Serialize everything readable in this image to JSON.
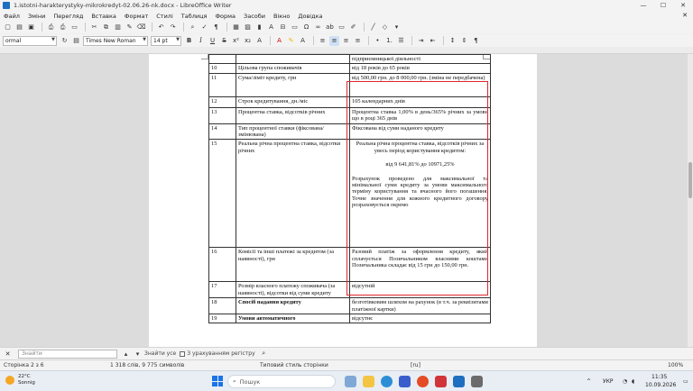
{
  "window": {
    "title": "1.istotni-harakterystyky-mikrokredyt-02.06.26-nk.docx - LibreOffice Writer",
    "min": "—",
    "max": "☐",
    "close": "✕"
  },
  "menu": {
    "items": [
      "Файл",
      "Зміни",
      "Перегляд",
      "Вставка",
      "Формат",
      "Стилі",
      "Таблиця",
      "Форма",
      "Засоби",
      "Вікно",
      "Довідка"
    ],
    "close_doc": "✕"
  },
  "toolbar": {
    "style_value": "ormal",
    "font_name": "Times New Roman",
    "font_size": "14 pt"
  },
  "table": {
    "rows": [
      {
        "num": "",
        "label": "",
        "value": "підприємницької діяльності"
      },
      {
        "num": "10",
        "label": "Цільова група споживачів",
        "value": "від 18 років до 65 років"
      },
      {
        "num": "11",
        "label": "Сума/ліміт кредиту, грн",
        "value": "від 500,00 грн. до 8 000,00 грн. (зміна не передбачена)"
      },
      {
        "num": "12",
        "label": "Строк кредитування, дн./міс",
        "value": "105 календарних днів"
      },
      {
        "num": "13",
        "label": "Процентна ставка, відсотків річних",
        "value": "Процентна ставка 1,00% в день/365% річних за умови що в році 365 днів"
      },
      {
        "num": "14",
        "label": "Тип процентної ставки (фіксована/змінювана)",
        "value": "Фіксована від суми наданого кредиту"
      },
      {
        "num": "15",
        "label": "Реальна річна процентна ставка, відсотки річних",
        "v1": "Реальна річна процентна ставка, відсотків річних за увесь період користування кредитом:",
        "v2": "від 9 641,81% до 10971,25%",
        "v3": "Розрахунок проведено для максимальної та мінімальної суми кредиту за умови максимального терміну користування та вчасного його погашення. Точне значення для кожного кредитного договору розраховується окремо"
      },
      {
        "num": "16",
        "label": "Комісії та інші платежі за кредитом (за наявності), грн",
        "value": "Разовий платіж за оформлення кредиту, який сплачується Позичальником власними коштами Позичальника складає від 15 грн до 150,00 грн."
      },
      {
        "num": "17",
        "label": "Розмір власного платежу споживача (за наявності), відсотки від суми кредиту",
        "value": "відсутній"
      },
      {
        "num": "18",
        "label": "Спосіб надання кредиту",
        "value": "безготівковим шляхом на рахунок (в т.ч. за реквізитами платіжної картки)"
      },
      {
        "num": "19",
        "label": "Умови автоматичного",
        "value": "відсутнє"
      }
    ]
  },
  "findbar": {
    "placeholder": "Знайти",
    "find_all": "Знайти усе",
    "match_case": "З урахуванням регістру",
    "close": "✕"
  },
  "status": {
    "page": "Сторінка 2 з 6",
    "words": "1 318 слів, 9 775 символів",
    "page_style": "Типовий стиль сторінки",
    "lang": "[ru]",
    "zoom": "100%"
  },
  "taskbar": {
    "temp": "22°C",
    "weather": "Sonnig",
    "search": "Пошук",
    "lang": "УКР",
    "time": "11:35",
    "date": "10.09.2026"
  },
  "colors": {
    "highlight_border": "#e0262b",
    "accent": "#1a73e8"
  }
}
